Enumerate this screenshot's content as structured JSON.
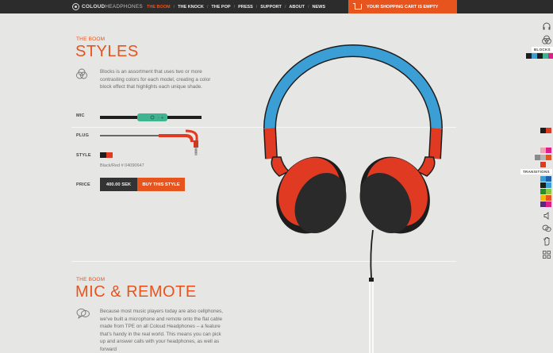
{
  "brand": {
    "bold": "COLOUD",
    "light": "HEADPHONES"
  },
  "nav": {
    "items": [
      "THE BOOM",
      "THE KNOCK",
      "THE POP",
      "PRESS",
      "SUPPORT",
      "ABOUT",
      "NEWS"
    ],
    "separator": "/"
  },
  "cart": {
    "label": "YOUR SHOPPING CART IS EMPTY"
  },
  "styles_section": {
    "eyebrow": "THE BOOM",
    "title": "STYLES",
    "description": "Blocks is an assortment that uses two or more contrasting colors for each model, creating a color block effect that highlights each unique shade.",
    "mic_label": "MIC",
    "plug_label": "PLUG",
    "style_label": "STYLE",
    "style_name": "Black/Red # 04090647",
    "price_label": "PRICE",
    "price": "400.00 SEK",
    "buy_label": "BUY THIS STYLE"
  },
  "mic_section": {
    "eyebrow": "THE BOOM",
    "title": "MIC & REMOTE",
    "description": "Because most music players today are also cellphones, we've built a microphone and remote onto the flat cable made from TPE on all Coloud Headphones – a feature that's handy in the real world. This means you can pick up and answer calls with your headphones, as well as forward"
  },
  "sidebar": {
    "blocks_label": "BLOCKS",
    "transitions_label": "TRANSITIONS"
  },
  "colors": {
    "accent": "#e8541d",
    "nav_bg": "#2c2c2c",
    "headband_blue": "#3b9fd6",
    "headband_red": "#e03a22",
    "remote_green": "#3fb491"
  }
}
